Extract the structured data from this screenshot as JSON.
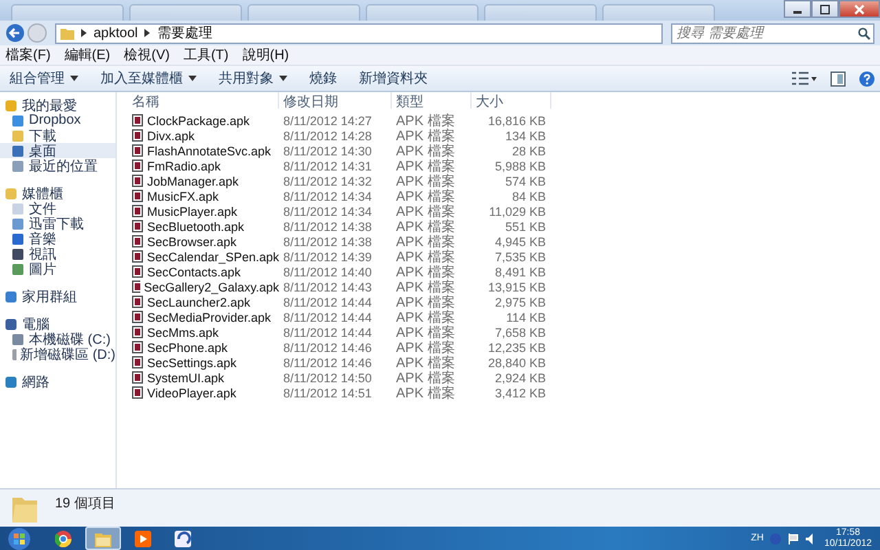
{
  "address": {
    "crumbs": [
      "apktool",
      "需要處理"
    ]
  },
  "search": {
    "placeholder": "搜尋 需要處理"
  },
  "menu": [
    "檔案(F)",
    "編輯(E)",
    "檢視(V)",
    "工具(T)",
    "說明(H)"
  ],
  "toolbar": [
    {
      "label": "組合管理",
      "dropdown": true
    },
    {
      "label": "加入至媒體櫃",
      "dropdown": true
    },
    {
      "label": "共用對象",
      "dropdown": true
    },
    {
      "label": "燒錄",
      "dropdown": false
    },
    {
      "label": "新增資料夾",
      "dropdown": false
    }
  ],
  "sidebar": [
    {
      "label": "我的最愛",
      "selected": false,
      "children": [
        {
          "label": "Dropbox",
          "selected": false
        },
        {
          "label": "下載",
          "selected": false
        },
        {
          "label": "桌面",
          "selected": true
        },
        {
          "label": "最近的位置",
          "selected": false
        }
      ]
    },
    {
      "label": "媒體櫃",
      "selected": false,
      "children": [
        {
          "label": "文件",
          "selected": false
        },
        {
          "label": "迅雷下載",
          "selected": false
        },
        {
          "label": "音樂",
          "selected": false
        },
        {
          "label": "視訊",
          "selected": false
        },
        {
          "label": "圖片",
          "selected": false
        }
      ]
    },
    {
      "label": "家用群組",
      "selected": false
    },
    {
      "label": "電腦",
      "selected": false,
      "children": [
        {
          "label": "本機磁碟 (C:)",
          "selected": false
        },
        {
          "label": "新增磁碟區 (D:)",
          "selected": false
        }
      ]
    },
    {
      "label": "網路",
      "selected": false
    }
  ],
  "table": {
    "columns": [
      "名稱",
      "修改日期",
      "類型",
      "大小"
    ],
    "rows": [
      [
        "ClockPackage.apk",
        "8/11/2012 14:27",
        "APK 檔案",
        "16,816 KB"
      ],
      [
        "Divx.apk",
        "8/11/2012 14:28",
        "APK 檔案",
        "134 KB"
      ],
      [
        "FlashAnnotateSvc.apk",
        "8/11/2012 14:30",
        "APK 檔案",
        "28 KB"
      ],
      [
        "FmRadio.apk",
        "8/11/2012 14:31",
        "APK 檔案",
        "5,988 KB"
      ],
      [
        "JobManager.apk",
        "8/11/2012 14:32",
        "APK 檔案",
        "574 KB"
      ],
      [
        "MusicFX.apk",
        "8/11/2012 14:34",
        "APK 檔案",
        "84 KB"
      ],
      [
        "MusicPlayer.apk",
        "8/11/2012 14:34",
        "APK 檔案",
        "11,029 KB"
      ],
      [
        "SecBluetooth.apk",
        "8/11/2012 14:38",
        "APK 檔案",
        "551 KB"
      ],
      [
        "SecBrowser.apk",
        "8/11/2012 14:38",
        "APK 檔案",
        "4,945 KB"
      ],
      [
        "SecCalendar_SPen.apk",
        "8/11/2012 14:39",
        "APK 檔案",
        "7,535 KB"
      ],
      [
        "SecContacts.apk",
        "8/11/2012 14:40",
        "APK 檔案",
        "8,491 KB"
      ],
      [
        "SecGallery2_Galaxy.apk",
        "8/11/2012 14:43",
        "APK 檔案",
        "13,915 KB"
      ],
      [
        "SecLauncher2.apk",
        "8/11/2012 14:44",
        "APK 檔案",
        "2,975 KB"
      ],
      [
        "SecMediaProvider.apk",
        "8/11/2012 14:44",
        "APK 檔案",
        "114 KB"
      ],
      [
        "SecMms.apk",
        "8/11/2012 14:44",
        "APK 檔案",
        "7,658 KB"
      ],
      [
        "SecPhone.apk",
        "8/11/2012 14:46",
        "APK 檔案",
        "12,235 KB"
      ],
      [
        "SecSettings.apk",
        "8/11/2012 14:46",
        "APK 檔案",
        "28,840 KB"
      ],
      [
        "SystemUI.apk",
        "8/11/2012 14:50",
        "APK 檔案",
        "2,924 KB"
      ],
      [
        "VideoPlayer.apk",
        "8/11/2012 14:51",
        "APK 檔案",
        "3,412 KB"
      ]
    ]
  },
  "status": {
    "count": "19 個項目"
  },
  "taskbar": {
    "apps": [
      {
        "selected": false
      },
      {
        "selected": true
      },
      {
        "selected": false
      },
      {
        "selected": false
      }
    ],
    "tray": {
      "language": "ZH"
    },
    "time": "17:58",
    "date": "10/11/2012"
  }
}
